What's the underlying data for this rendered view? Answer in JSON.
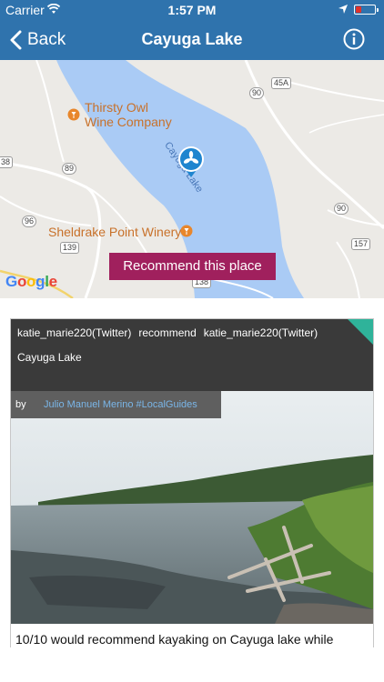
{
  "status_bar": {
    "carrier": "Carrier",
    "time": "1:57 PM",
    "battery_color": "#e0322b"
  },
  "nav": {
    "back_label": "Back",
    "title": "Cayuga Lake",
    "info_icon": "info-circle-icon",
    "bar_color": "#2f73ad"
  },
  "map": {
    "labels": {
      "thirsty_owl": "Thirsty Owl\nWine Company",
      "sheldrake": "Sheldrake Point Winery",
      "lake": "Cayuga Lake"
    },
    "road_shields": [
      "45A",
      "90",
      "38",
      "89",
      "96",
      "90",
      "139",
      "157",
      "138"
    ],
    "recommend_button": "Recommend this place",
    "google_logo": "Google",
    "accent_color": "#a0205d",
    "water_color": "#aacbf5"
  },
  "post": {
    "header_user": "katie_marie220(Twitter)",
    "header_verb": "recommend",
    "header_target": "katie_marie220(Twitter)",
    "place": "Cayuga Lake",
    "by_label": "by",
    "author": "Julio Manuel Merino #LocalGuides",
    "caption": "10/10 would recommend kayaking on Cayuga lake while",
    "corner_color": "#2fb39a"
  }
}
